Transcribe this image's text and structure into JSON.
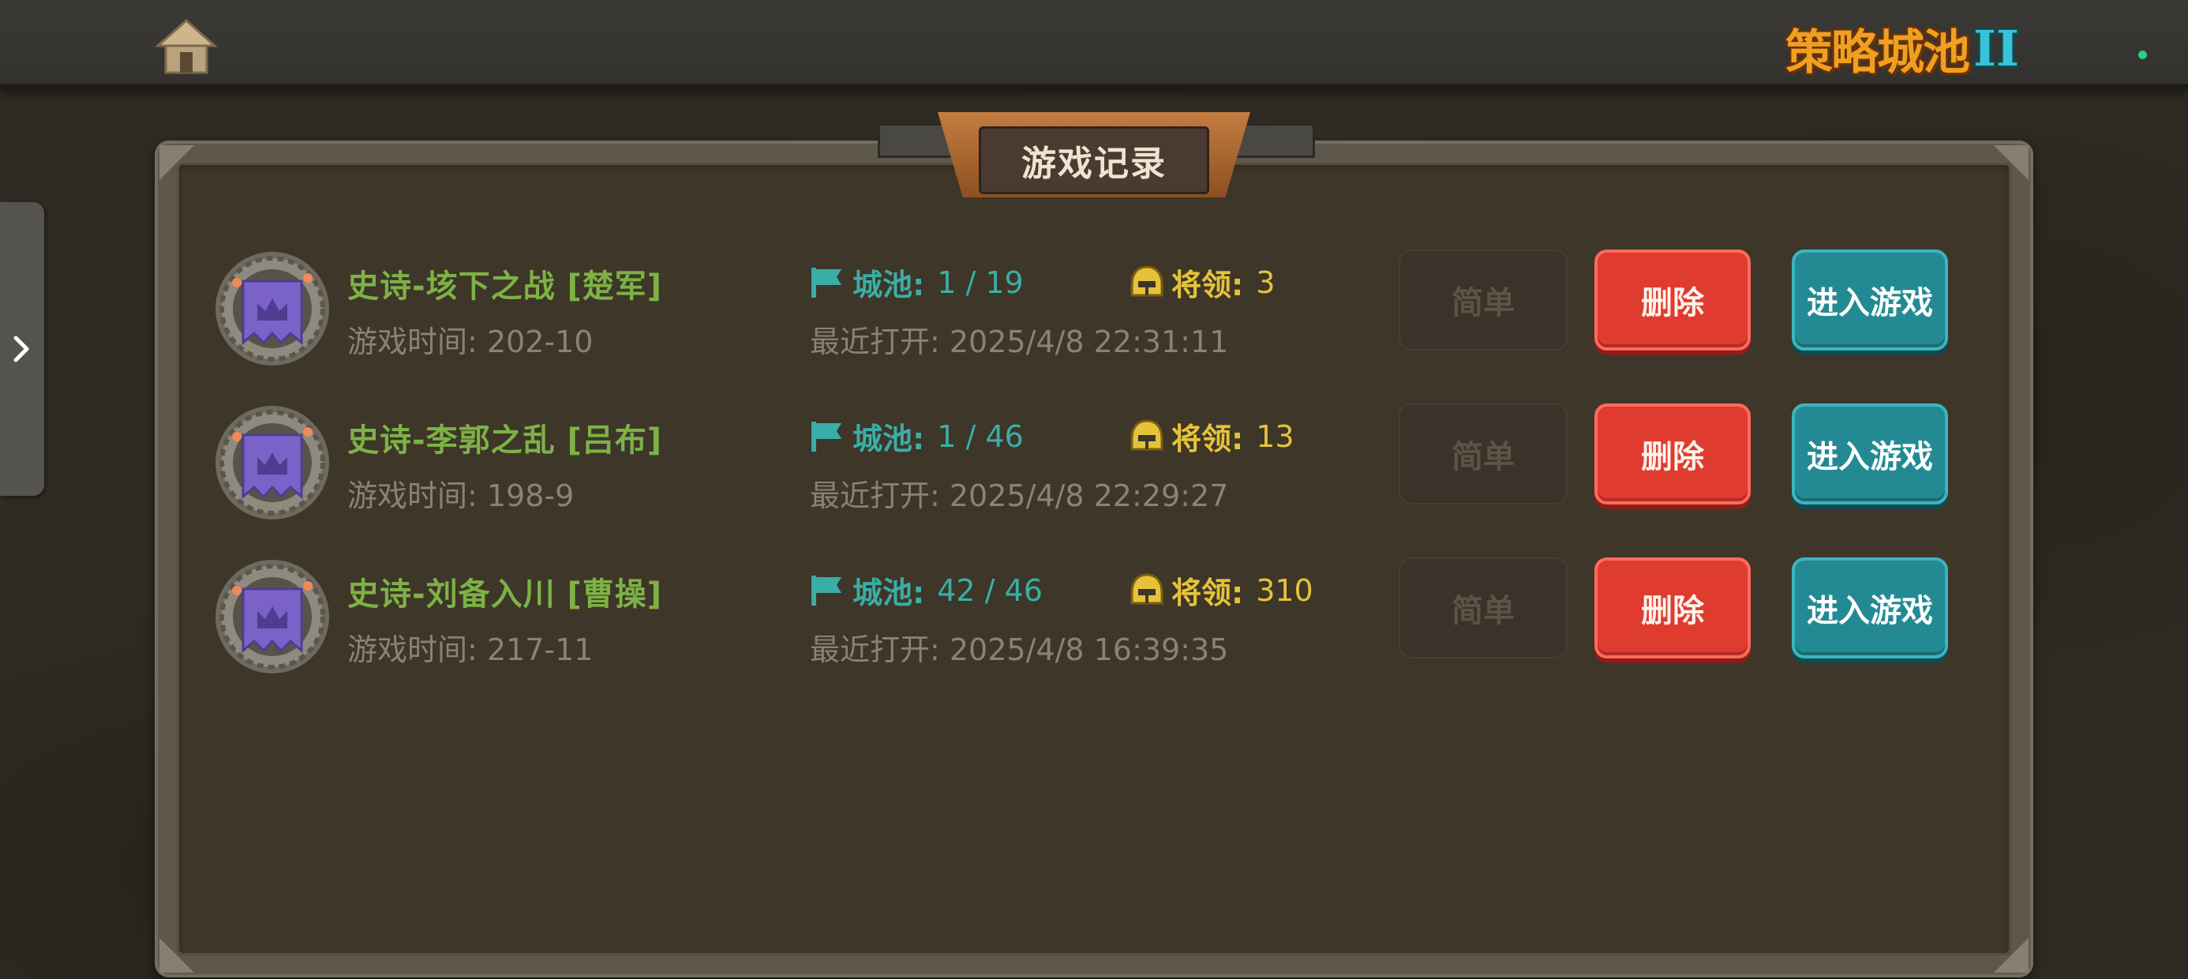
{
  "header": {
    "logo_text": "策略城池",
    "logo_numeral": "II"
  },
  "panel": {
    "title": "游戏记录"
  },
  "records": [
    {
      "name": "史诗-垓下之战 [楚军]",
      "play_time": "游戏时间: 202-10",
      "cities_label": "城池:",
      "cities_value": "1 / 19",
      "generals_label": "将领:",
      "generals_value": "3",
      "last_opened": "最近打开: 2025/4/8 22:31:11",
      "difficulty": "简单",
      "delete_label": "删除",
      "enter_label": "进入游戏"
    },
    {
      "name": "史诗-李郭之乱 [吕布]",
      "play_time": "游戏时间: 198-9",
      "cities_label": "城池:",
      "cities_value": "1 / 46",
      "generals_label": "将领:",
      "generals_value": "13",
      "last_opened": "最近打开: 2025/4/8 22:29:27",
      "difficulty": "简单",
      "delete_label": "删除",
      "enter_label": "进入游戏"
    },
    {
      "name": "史诗-刘备入川 [曹操]",
      "play_time": "游戏时间: 217-11",
      "cities_label": "城池:",
      "cities_value": "42 / 46",
      "generals_label": "将领:",
      "generals_value": "310",
      "last_opened": "最近打开: 2025/4/8 16:39:35",
      "difficulty": "简单",
      "delete_label": "删除",
      "enter_label": "进入游戏"
    }
  ],
  "icons": {
    "home": "home-icon",
    "side_toggle": "chevron-right-icon",
    "badge": "crown-banner-icon",
    "cities": "flag-icon",
    "generals": "helmet-icon"
  },
  "colors": {
    "accent_green": "#7db245",
    "accent_teal": "#3aaea6",
    "accent_gold": "#e6c23a",
    "delete_red": "#df3b2f",
    "enter_teal": "#238a93"
  }
}
